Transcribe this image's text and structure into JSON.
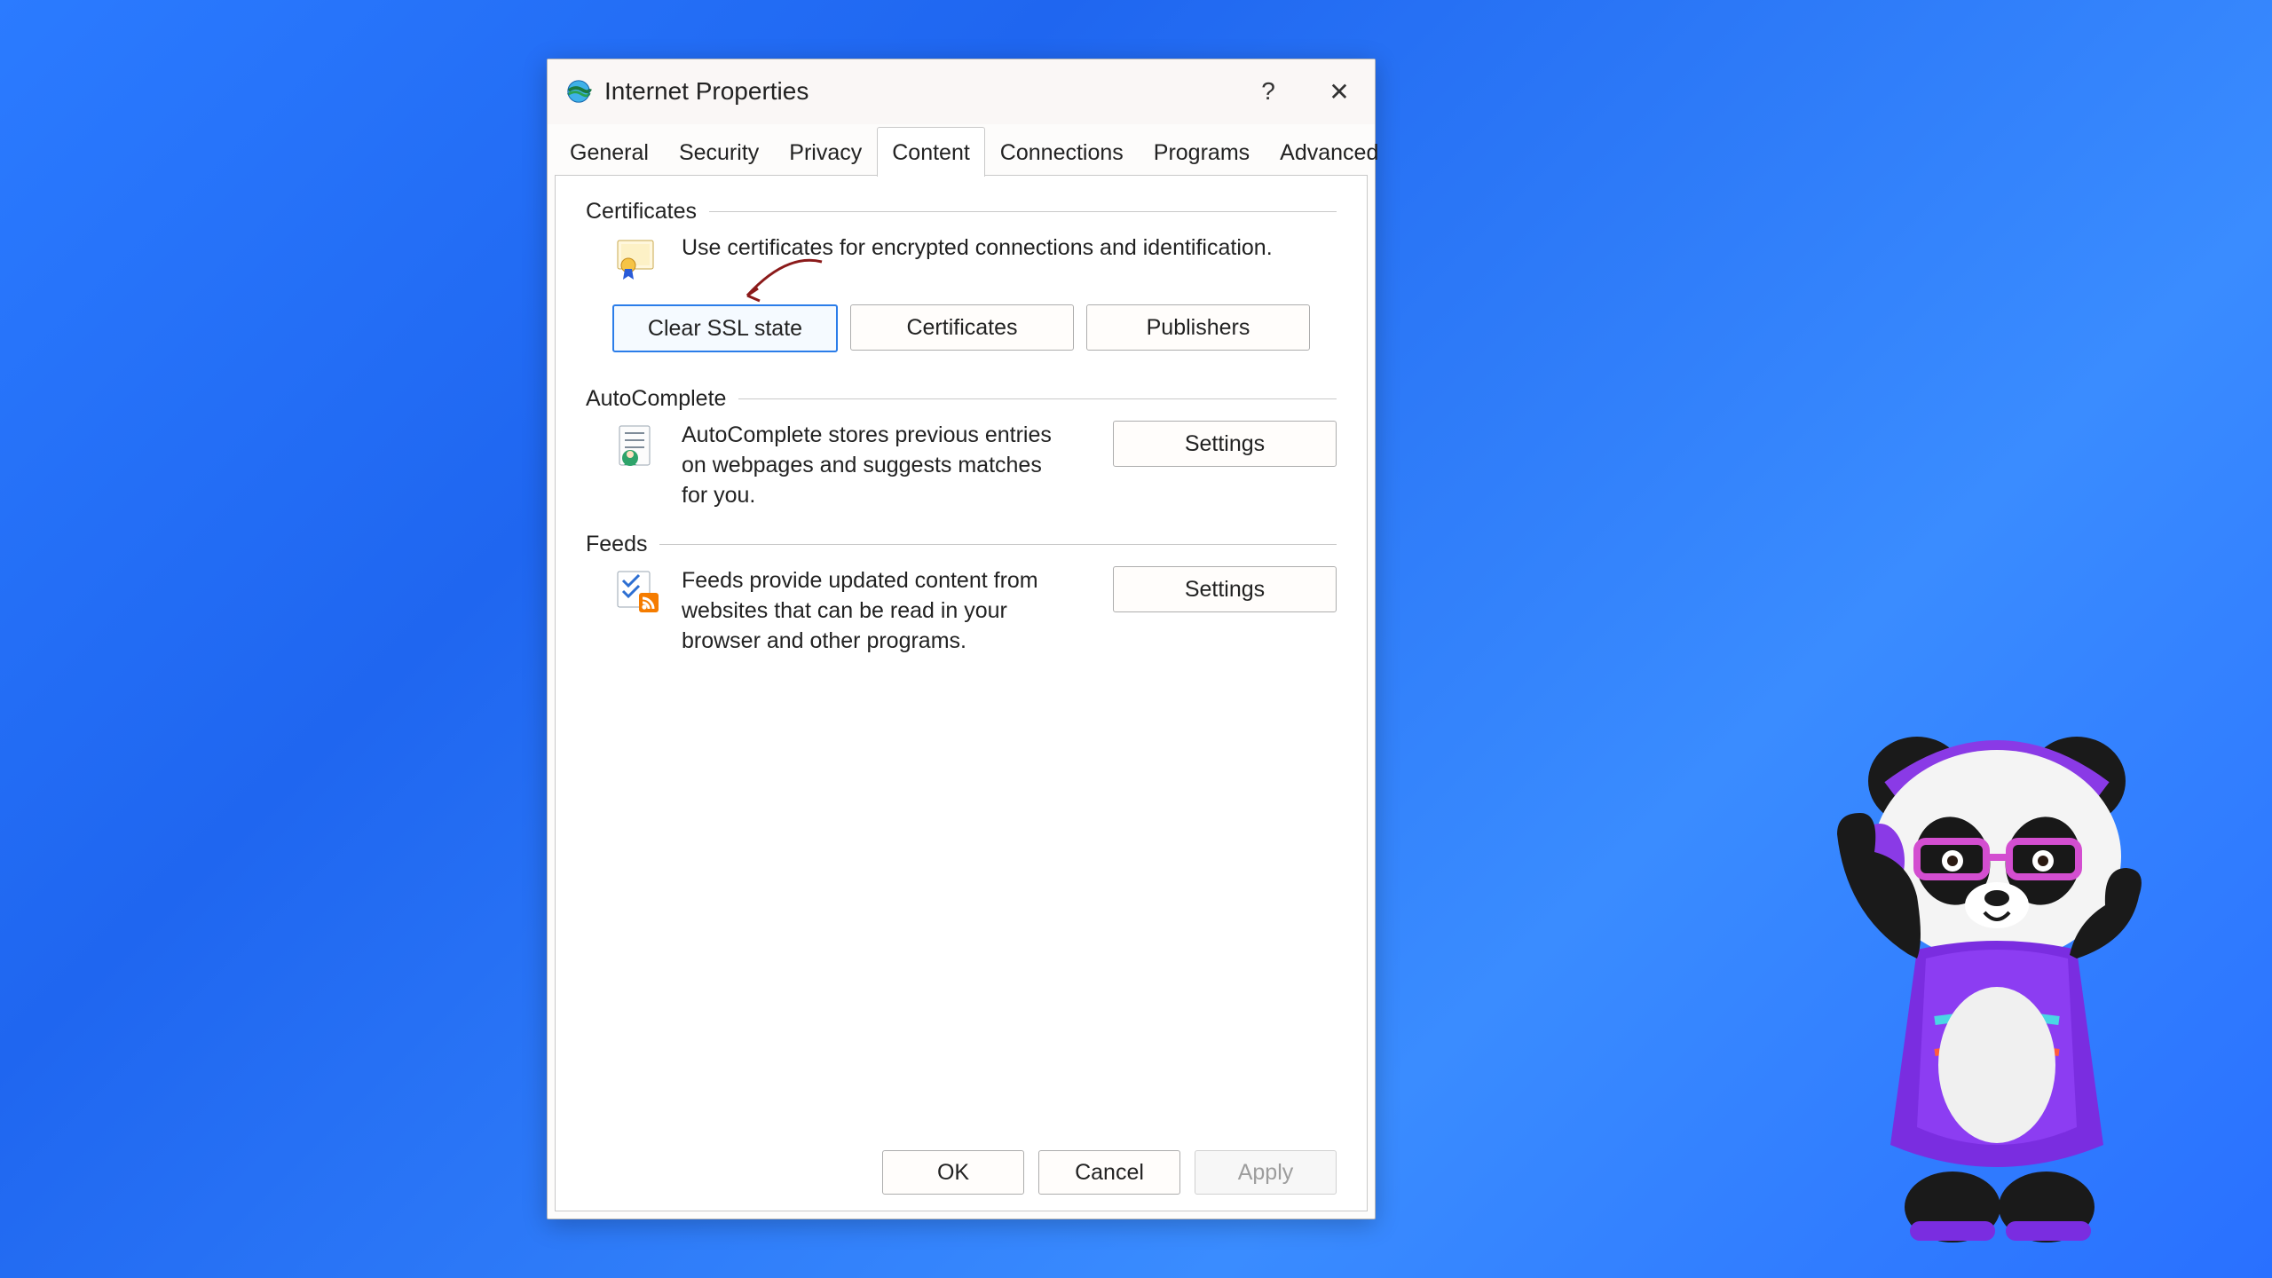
{
  "title": "Internet Properties",
  "tabs": [
    "General",
    "Security",
    "Privacy",
    "Content",
    "Connections",
    "Programs",
    "Advanced"
  ],
  "active_tab": "Content",
  "sections": {
    "certificates": {
      "header": "Certificates",
      "description": "Use certificates for encrypted connections and identification.",
      "buttons": {
        "clear_ssl": "Clear SSL state",
        "certificates": "Certificates",
        "publishers": "Publishers"
      }
    },
    "autocomplete": {
      "header": "AutoComplete",
      "description": "AutoComplete stores previous entries on webpages and suggests matches for you.",
      "settings": "Settings"
    },
    "feeds": {
      "header": "Feeds",
      "description": "Feeds provide updated content from websites that can be read in your browser and other programs.",
      "settings": "Settings"
    }
  },
  "dialog_buttons": {
    "ok": "OK",
    "cancel": "Cancel",
    "apply": "Apply"
  },
  "titlebar_buttons": {
    "help": "?",
    "close": "✕"
  }
}
